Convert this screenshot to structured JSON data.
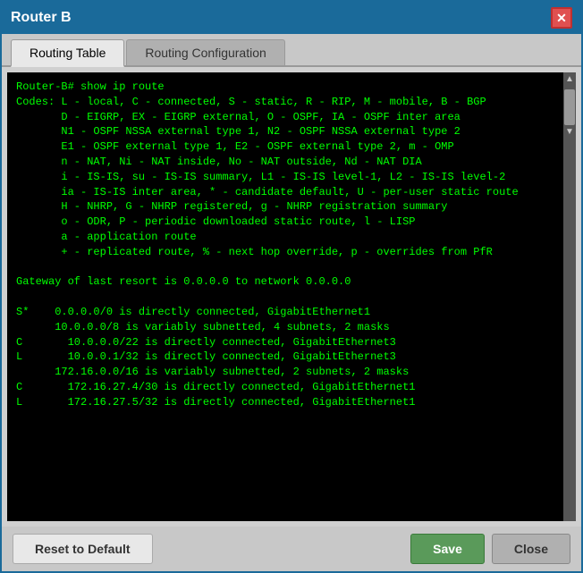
{
  "title_bar": {
    "title": "Router B",
    "close_label": "✕"
  },
  "tabs": [
    {
      "label": "Routing Table",
      "active": true
    },
    {
      "label": "Routing Configuration",
      "active": false
    }
  ],
  "terminal": {
    "prompt": "Router-B# show ip route",
    "content": "\nCodes: L - local, C - connected, S - static, R - RIP, M - mobile, B - BGP\n       D - EIGRP, EX - EIGRP external, O - OSPF, IA - OSPF inter area\n       N1 - OSPF NSSA external type 1, N2 - OSPF NSSA external type 2\n       E1 - OSPF external type 1, E2 - OSPF external type 2, m - OMP\n       n - NAT, Ni - NAT inside, No - NAT outside, Nd - NAT DIA\n       i - IS-IS, su - IS-IS summary, L1 - IS-IS level-1, L2 - IS-IS level-2\n       ia - IS-IS inter area, * - candidate default, U - per-user static route\n       H - NHRP, G - NHRP registered, g - NHRP registration summary\n       o - ODR, P - periodic downloaded static route, l - LISP\n       a - application route\n       + - replicated route, % - next hop override, p - overrides from PfR\n\nGateway of last resort is 0.0.0.0 to network 0.0.0.0\n\nS*    0.0.0.0/0 is directly connected, GigabitEthernet1\n      10.0.0.0/8 is variably subnetted, 4 subnets, 2 masks\nC       10.0.0.0/22 is directly connected, GigabitEthernet3\nL       10.0.0.1/32 is directly connected, GigabitEthernet3\n      172.16.0.0/16 is variably subnetted, 2 subnets, 2 masks\nC       172.16.27.4/30 is directly connected, GigabitEthernet1\nL       172.16.27.5/32 is directly connected, GigabitEthernet1"
  },
  "footer": {
    "reset_label": "Reset to Default",
    "save_label": "Save",
    "close_label": "Close"
  }
}
